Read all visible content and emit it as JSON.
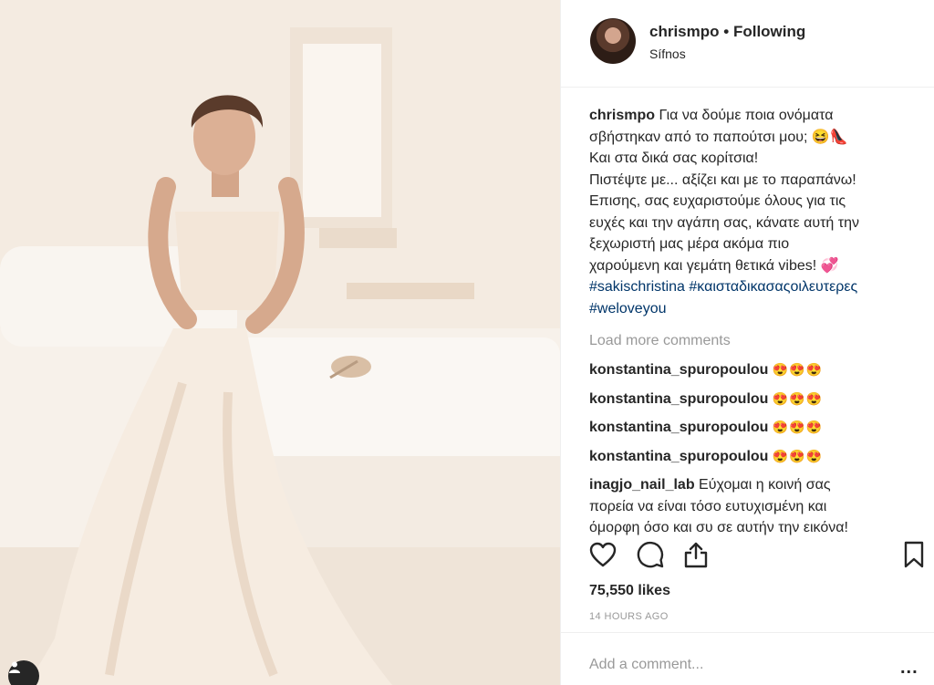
{
  "header": {
    "username": "chrismpo",
    "separator": "•",
    "follow_status": "Following",
    "location": "Sífnos"
  },
  "caption": {
    "username": "chrismpo",
    "lines": [
      "Για να δούμε ποια ονόματα",
      "σβήστηκαν από το παπούτσι μου; 😆👠",
      "Και στα δικά σας κορίτσια!",
      "Πιστέψτε με... αξίζει και με το παραπάνω!",
      "Επισης, σας ευχαριστούμε όλους για τις",
      "ευχές και την αγάπη σας, κάνατε αυτή την",
      "ξεχωριστή μας μέρα ακόμα πιο",
      "χαρούμενη και γεμάτη θετικά vibes! 💞"
    ],
    "hashtags": [
      "#sakischristina",
      "#καισταδικασαςοιλευτερες",
      "#weloveyou"
    ]
  },
  "load_more": "Load more comments",
  "comments": [
    {
      "username": "konstantina_spuropoulou",
      "text": "😍😍😍"
    },
    {
      "username": "konstantina_spuropoulou",
      "text": "😍😍😍"
    },
    {
      "username": "konstantina_spuropoulou",
      "text": "😍😍😍"
    },
    {
      "username": "konstantina_spuropoulou",
      "text": "😍😍😍"
    },
    {
      "username": "inagjo_nail_lab",
      "lines": [
        "Εύχομαι η κοινή σας",
        "πορεία να είναι τόσο ευτυχισμένη και",
        "όμορφη όσο και συ σε αυτήν την εικόνα!"
      ]
    }
  ],
  "icons": {
    "like": "heart-icon",
    "comment": "comment-bubble-icon",
    "share": "share-icon",
    "save": "bookmark-icon",
    "tagged_users": "user-tag-icon"
  },
  "likes": "75,550 likes",
  "timestamp": "14 HOURS AGO",
  "add_comment": {
    "placeholder": "Add a comment...",
    "more": "..."
  },
  "colors": {
    "hashtag": "#003569",
    "muted": "#999999",
    "text": "#262626"
  }
}
